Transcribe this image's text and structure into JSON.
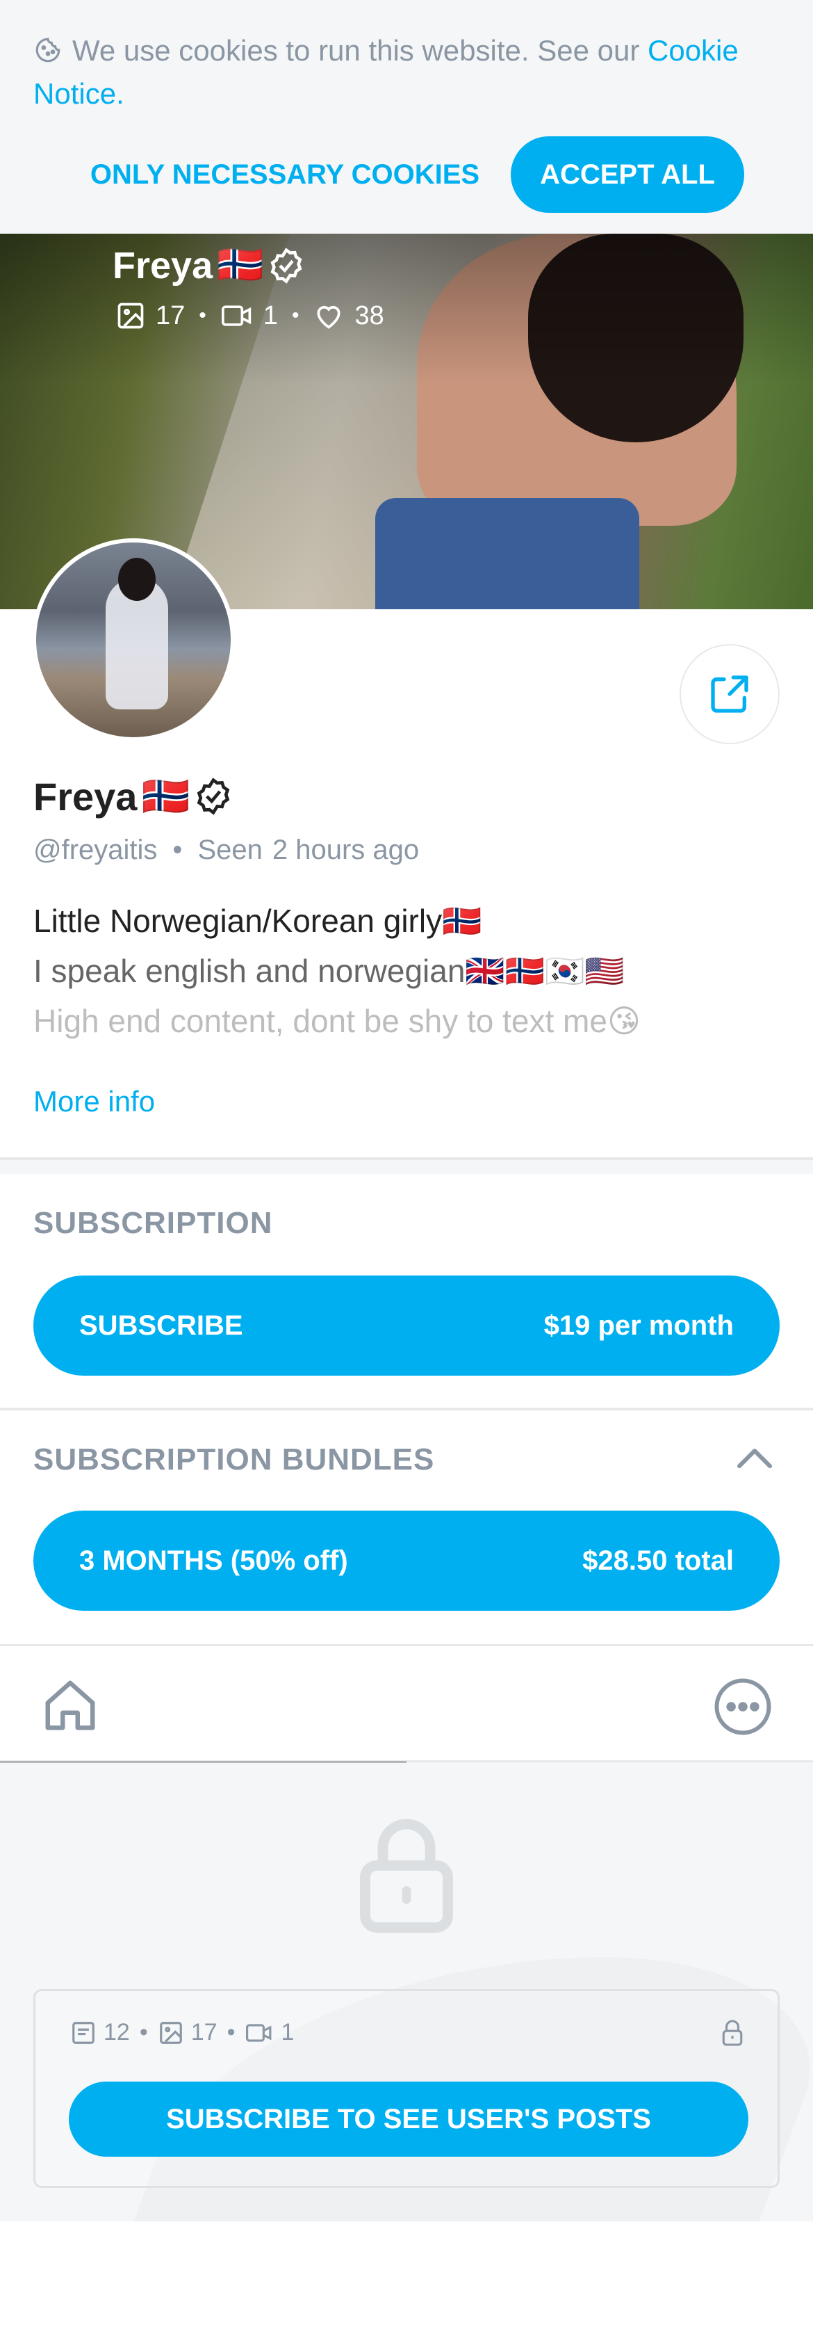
{
  "cookie": {
    "text": "We use cookies to run this website. See our",
    "link": "Cookie Notice",
    "period": ".",
    "necessary_label": "ONLY NECESSARY COOKIES",
    "accept_label": "ACCEPT ALL"
  },
  "cover": {
    "name": "Freya",
    "name_emoji": "🇳🇴",
    "images": "17",
    "videos": "1",
    "likes": "38"
  },
  "profile": {
    "name": "Freya",
    "name_emoji": "🇳🇴",
    "handle": "@freyaitis",
    "seen_label": "Seen",
    "seen_time": "2 hours ago",
    "bio": [
      "Little Norwegian/Korean girly🇳🇴",
      "I speak english and norwegian🇬🇧🇳🇴🇰🇷🇺🇸",
      "High end content, dont be shy to text me😘"
    ],
    "more_info": "More info"
  },
  "subscription": {
    "title": "SUBSCRIPTION",
    "button_label": "SUBSCRIBE",
    "button_price": "$19 per month"
  },
  "bundles": {
    "title": "SUBSCRIPTION BUNDLES",
    "items": [
      {
        "label": "3 MONTHS (50% off)",
        "price": "$28.50 total"
      }
    ]
  },
  "locked": {
    "posts": "12",
    "images": "17",
    "videos": "1",
    "button_label": "SUBSCRIBE TO SEE USER'S POSTS"
  },
  "colors": {
    "accent": "#00aff0",
    "muted": "#8a96a3"
  }
}
